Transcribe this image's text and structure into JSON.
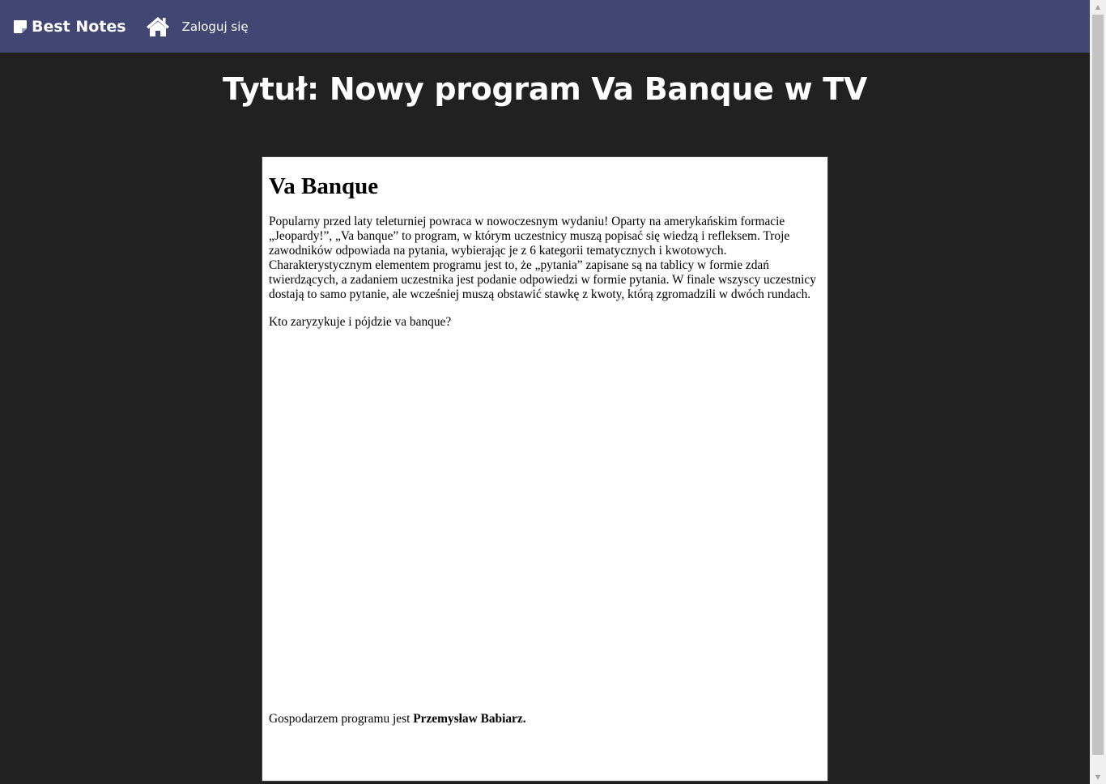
{
  "navbar": {
    "brand_label": "Best Notes",
    "brand_icon": "note-icon",
    "home_icon": "home-icon",
    "login_label": "Zaloguj się",
    "background_color": "#414772"
  },
  "page": {
    "title": "Tytuł: Nowy program Va Banque w TV",
    "background_color": "#212121"
  },
  "note": {
    "heading": "Va Banque",
    "paragraphs": [
      "Popularny przed laty teleturniej powraca w nowoczesnym wydaniu! Oparty na amerykańskim formacie „Jeopardy!”, „Va banque” to program, w którym uczestnicy muszą popisać się wiedzą i refleksem. Troje zawodników odpowiada na pytania, wybierając je z 6 kategorii tematycznych i kwotowych. Charakterystycznym elementem programu jest to, że „pytania” zapisane są na tablicy w formie zdań twierdzących, a zadaniem uczestnika jest podanie odpowiedzi w formie pytania. W finale wszyscy uczestnicy dostają to samo pytanie, ale wcześniej muszą obstawić stawkę z kwoty, którą zgromadzili w dwóch rundach.",
      "Kto zaryzykuje i pójdzie va banque?"
    ],
    "footer_text": "Gospodarzem programu jest ",
    "footer_bold": "Przemysław Babiarz."
  }
}
